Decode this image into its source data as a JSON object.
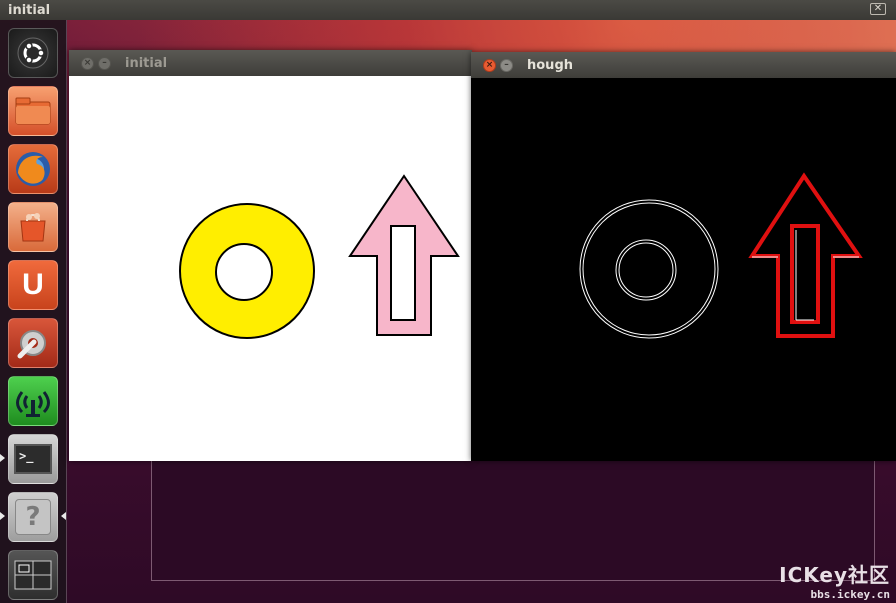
{
  "top_panel": {
    "title": "initial",
    "close_glyph": "✕"
  },
  "launcher": {
    "items": [
      {
        "name": "dash-home-icon"
      },
      {
        "name": "files-folder-icon"
      },
      {
        "name": "firefox-icon"
      },
      {
        "name": "software-center-icon"
      },
      {
        "name": "ubuntu-one-icon",
        "glyph": "U"
      },
      {
        "name": "system-settings-icon"
      },
      {
        "name": "network-icon"
      },
      {
        "name": "terminal-icon",
        "glyph": ">_"
      },
      {
        "name": "help-icon",
        "glyph": "?"
      },
      {
        "name": "workspace-switcher-icon"
      }
    ]
  },
  "windows": {
    "initial": {
      "title": "initial"
    },
    "hough": {
      "title": "hough"
    }
  },
  "colors": {
    "ring_fill": "#ffee00",
    "arrow_fill": "#f7b6ca",
    "detect_red": "#e01010",
    "edge_white": "#ffffff"
  },
  "watermark": {
    "line1": "ICKey社区",
    "line2": "bbs.ickey.cn"
  }
}
